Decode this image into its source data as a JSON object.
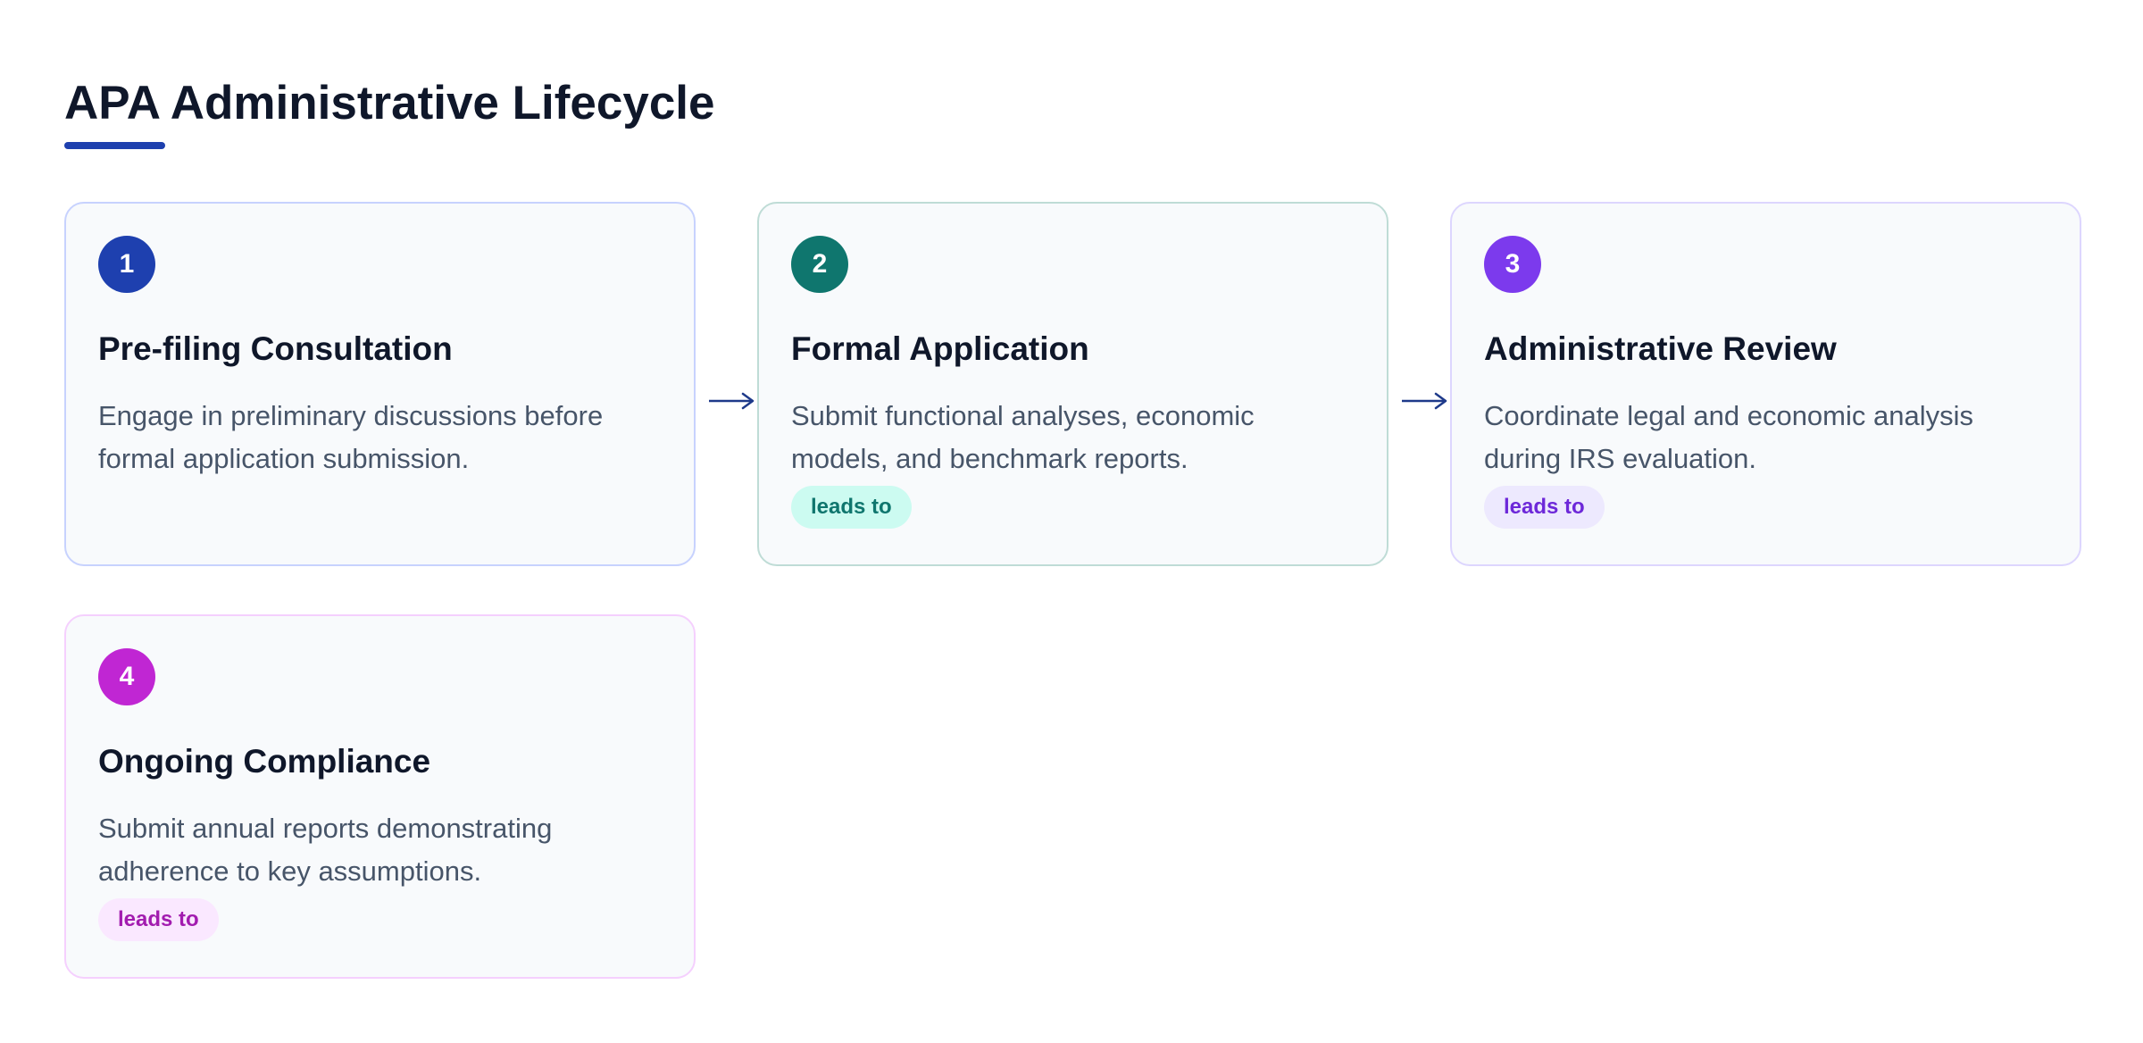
{
  "title": "APA Administrative Lifecycle",
  "colors": {
    "title_underline": "#1e40af",
    "arrow": "#1e3a8a"
  },
  "steps": [
    {
      "number": "1",
      "title": "Pre-filing Consultation",
      "description": "Engage in preliminary discussions before formal application submission.",
      "badge_color": "#1e40af",
      "border_color": "#c7d2fe"
    },
    {
      "number": "2",
      "title": "Formal Application",
      "description": "Submit functional analyses, economic models, and benchmark reports.",
      "tag": "leads to",
      "badge_color": "#0f766e",
      "border_color": "#bfdcd6",
      "tag_bg": "#ccfbf1",
      "tag_color": "#0f766e"
    },
    {
      "number": "3",
      "title": "Administrative Review",
      "description": "Coordinate legal and economic analysis during IRS evaluation.",
      "tag": "leads to",
      "badge_color": "#7c3aed",
      "border_color": "#ddd6fe",
      "tag_bg": "#ede9fe",
      "tag_color": "#6d28d9"
    },
    {
      "number": "4",
      "title": "Ongoing Compliance",
      "description": "Submit annual reports demonstrating adherence to key assumptions.",
      "tag": "leads to",
      "badge_color": "#c026d3",
      "border_color": "#f5d0fe",
      "tag_bg": "#fae8ff",
      "tag_color": "#a21caf"
    }
  ]
}
